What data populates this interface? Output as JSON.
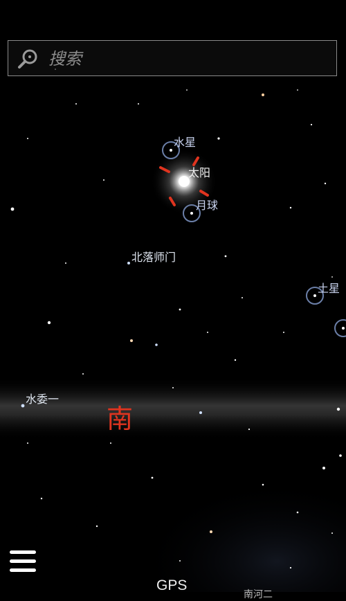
{
  "search": {
    "placeholder": "搜索",
    "icon": "search-icon"
  },
  "labels": {
    "mercury": "水星",
    "sun": "太阳",
    "moon": "月球",
    "fomalhaut": "北落师门",
    "saturn": "土星",
    "achernar_ish": "水委一",
    "partial_bottom": "南河二"
  },
  "compass": {
    "direction": "南",
    "color": "#e0341f"
  },
  "bottom": {
    "gps_label": "GPS",
    "menu_icon": "hamburger-menu-icon"
  },
  "colors": {
    "sky": "#000000",
    "horizon_band": "#3a3a3a",
    "planet_ring": "#6b7fa8",
    "sun_marker": "#e0341f"
  }
}
